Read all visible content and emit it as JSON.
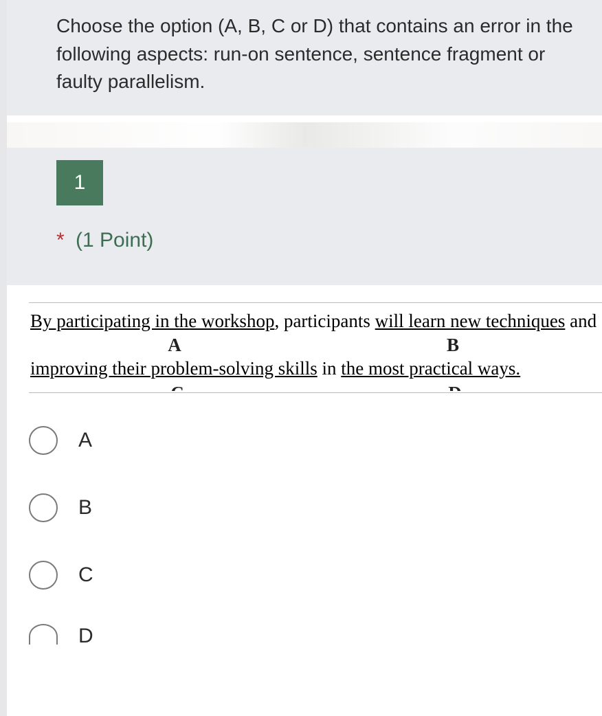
{
  "instructions": "Choose the option (A, B, C or D) that contains an error in the following aspects: run-on sentence, sentence fragment or faulty parallelism.",
  "question": {
    "number": "1",
    "required_mark": "*",
    "points_label": "(1 Point)",
    "sentence": {
      "line1": {
        "seg_a_underlined": "By participating in the workshop",
        "after_a": ", participants ",
        "seg_b_underlined": "will learn new techniques",
        "after_b": " and"
      },
      "line2": {
        "seg_c_underlined": "improving their problem-solving skills",
        "between": " in ",
        "seg_d_underlined": "the most practical ways."
      },
      "labels": {
        "a": "A",
        "b": "B",
        "c": "C",
        "d": "D"
      }
    }
  },
  "options": [
    {
      "label": "A"
    },
    {
      "label": "B"
    },
    {
      "label": "C"
    },
    {
      "label": "D"
    }
  ]
}
